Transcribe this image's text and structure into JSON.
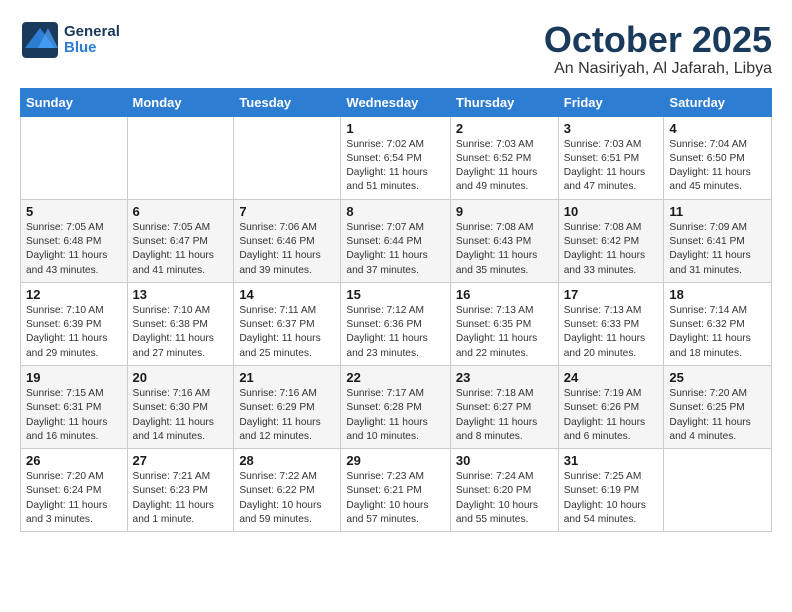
{
  "logo": {
    "general": "General",
    "blue": "Blue"
  },
  "header": {
    "month": "October 2025",
    "location": "An Nasiriyah, Al Jafarah, Libya"
  },
  "weekdays": [
    "Sunday",
    "Monday",
    "Tuesday",
    "Wednesday",
    "Thursday",
    "Friday",
    "Saturday"
  ],
  "weeks": [
    [
      {
        "day": "",
        "sunrise": "",
        "sunset": "",
        "daylight": ""
      },
      {
        "day": "",
        "sunrise": "",
        "sunset": "",
        "daylight": ""
      },
      {
        "day": "",
        "sunrise": "",
        "sunset": "",
        "daylight": ""
      },
      {
        "day": "1",
        "sunrise": "Sunrise: 7:02 AM",
        "sunset": "Sunset: 6:54 PM",
        "daylight": "Daylight: 11 hours and 51 minutes."
      },
      {
        "day": "2",
        "sunrise": "Sunrise: 7:03 AM",
        "sunset": "Sunset: 6:52 PM",
        "daylight": "Daylight: 11 hours and 49 minutes."
      },
      {
        "day": "3",
        "sunrise": "Sunrise: 7:03 AM",
        "sunset": "Sunset: 6:51 PM",
        "daylight": "Daylight: 11 hours and 47 minutes."
      },
      {
        "day": "4",
        "sunrise": "Sunrise: 7:04 AM",
        "sunset": "Sunset: 6:50 PM",
        "daylight": "Daylight: 11 hours and 45 minutes."
      }
    ],
    [
      {
        "day": "5",
        "sunrise": "Sunrise: 7:05 AM",
        "sunset": "Sunset: 6:48 PM",
        "daylight": "Daylight: 11 hours and 43 minutes."
      },
      {
        "day": "6",
        "sunrise": "Sunrise: 7:05 AM",
        "sunset": "Sunset: 6:47 PM",
        "daylight": "Daylight: 11 hours and 41 minutes."
      },
      {
        "day": "7",
        "sunrise": "Sunrise: 7:06 AM",
        "sunset": "Sunset: 6:46 PM",
        "daylight": "Daylight: 11 hours and 39 minutes."
      },
      {
        "day": "8",
        "sunrise": "Sunrise: 7:07 AM",
        "sunset": "Sunset: 6:44 PM",
        "daylight": "Daylight: 11 hours and 37 minutes."
      },
      {
        "day": "9",
        "sunrise": "Sunrise: 7:08 AM",
        "sunset": "Sunset: 6:43 PM",
        "daylight": "Daylight: 11 hours and 35 minutes."
      },
      {
        "day": "10",
        "sunrise": "Sunrise: 7:08 AM",
        "sunset": "Sunset: 6:42 PM",
        "daylight": "Daylight: 11 hours and 33 minutes."
      },
      {
        "day": "11",
        "sunrise": "Sunrise: 7:09 AM",
        "sunset": "Sunset: 6:41 PM",
        "daylight": "Daylight: 11 hours and 31 minutes."
      }
    ],
    [
      {
        "day": "12",
        "sunrise": "Sunrise: 7:10 AM",
        "sunset": "Sunset: 6:39 PM",
        "daylight": "Daylight: 11 hours and 29 minutes."
      },
      {
        "day": "13",
        "sunrise": "Sunrise: 7:10 AM",
        "sunset": "Sunset: 6:38 PM",
        "daylight": "Daylight: 11 hours and 27 minutes."
      },
      {
        "day": "14",
        "sunrise": "Sunrise: 7:11 AM",
        "sunset": "Sunset: 6:37 PM",
        "daylight": "Daylight: 11 hours and 25 minutes."
      },
      {
        "day": "15",
        "sunrise": "Sunrise: 7:12 AM",
        "sunset": "Sunset: 6:36 PM",
        "daylight": "Daylight: 11 hours and 23 minutes."
      },
      {
        "day": "16",
        "sunrise": "Sunrise: 7:13 AM",
        "sunset": "Sunset: 6:35 PM",
        "daylight": "Daylight: 11 hours and 22 minutes."
      },
      {
        "day": "17",
        "sunrise": "Sunrise: 7:13 AM",
        "sunset": "Sunset: 6:33 PM",
        "daylight": "Daylight: 11 hours and 20 minutes."
      },
      {
        "day": "18",
        "sunrise": "Sunrise: 7:14 AM",
        "sunset": "Sunset: 6:32 PM",
        "daylight": "Daylight: 11 hours and 18 minutes."
      }
    ],
    [
      {
        "day": "19",
        "sunrise": "Sunrise: 7:15 AM",
        "sunset": "Sunset: 6:31 PM",
        "daylight": "Daylight: 11 hours and 16 minutes."
      },
      {
        "day": "20",
        "sunrise": "Sunrise: 7:16 AM",
        "sunset": "Sunset: 6:30 PM",
        "daylight": "Daylight: 11 hours and 14 minutes."
      },
      {
        "day": "21",
        "sunrise": "Sunrise: 7:16 AM",
        "sunset": "Sunset: 6:29 PM",
        "daylight": "Daylight: 11 hours and 12 minutes."
      },
      {
        "day": "22",
        "sunrise": "Sunrise: 7:17 AM",
        "sunset": "Sunset: 6:28 PM",
        "daylight": "Daylight: 11 hours and 10 minutes."
      },
      {
        "day": "23",
        "sunrise": "Sunrise: 7:18 AM",
        "sunset": "Sunset: 6:27 PM",
        "daylight": "Daylight: 11 hours and 8 minutes."
      },
      {
        "day": "24",
        "sunrise": "Sunrise: 7:19 AM",
        "sunset": "Sunset: 6:26 PM",
        "daylight": "Daylight: 11 hours and 6 minutes."
      },
      {
        "day": "25",
        "sunrise": "Sunrise: 7:20 AM",
        "sunset": "Sunset: 6:25 PM",
        "daylight": "Daylight: 11 hours and 4 minutes."
      }
    ],
    [
      {
        "day": "26",
        "sunrise": "Sunrise: 7:20 AM",
        "sunset": "Sunset: 6:24 PM",
        "daylight": "Daylight: 11 hours and 3 minutes."
      },
      {
        "day": "27",
        "sunrise": "Sunrise: 7:21 AM",
        "sunset": "Sunset: 6:23 PM",
        "daylight": "Daylight: 11 hours and 1 minute."
      },
      {
        "day": "28",
        "sunrise": "Sunrise: 7:22 AM",
        "sunset": "Sunset: 6:22 PM",
        "daylight": "Daylight: 10 hours and 59 minutes."
      },
      {
        "day": "29",
        "sunrise": "Sunrise: 7:23 AM",
        "sunset": "Sunset: 6:21 PM",
        "daylight": "Daylight: 10 hours and 57 minutes."
      },
      {
        "day": "30",
        "sunrise": "Sunrise: 7:24 AM",
        "sunset": "Sunset: 6:20 PM",
        "daylight": "Daylight: 10 hours and 55 minutes."
      },
      {
        "day": "31",
        "sunrise": "Sunrise: 7:25 AM",
        "sunset": "Sunset: 6:19 PM",
        "daylight": "Daylight: 10 hours and 54 minutes."
      },
      {
        "day": "",
        "sunrise": "",
        "sunset": "",
        "daylight": ""
      }
    ]
  ]
}
